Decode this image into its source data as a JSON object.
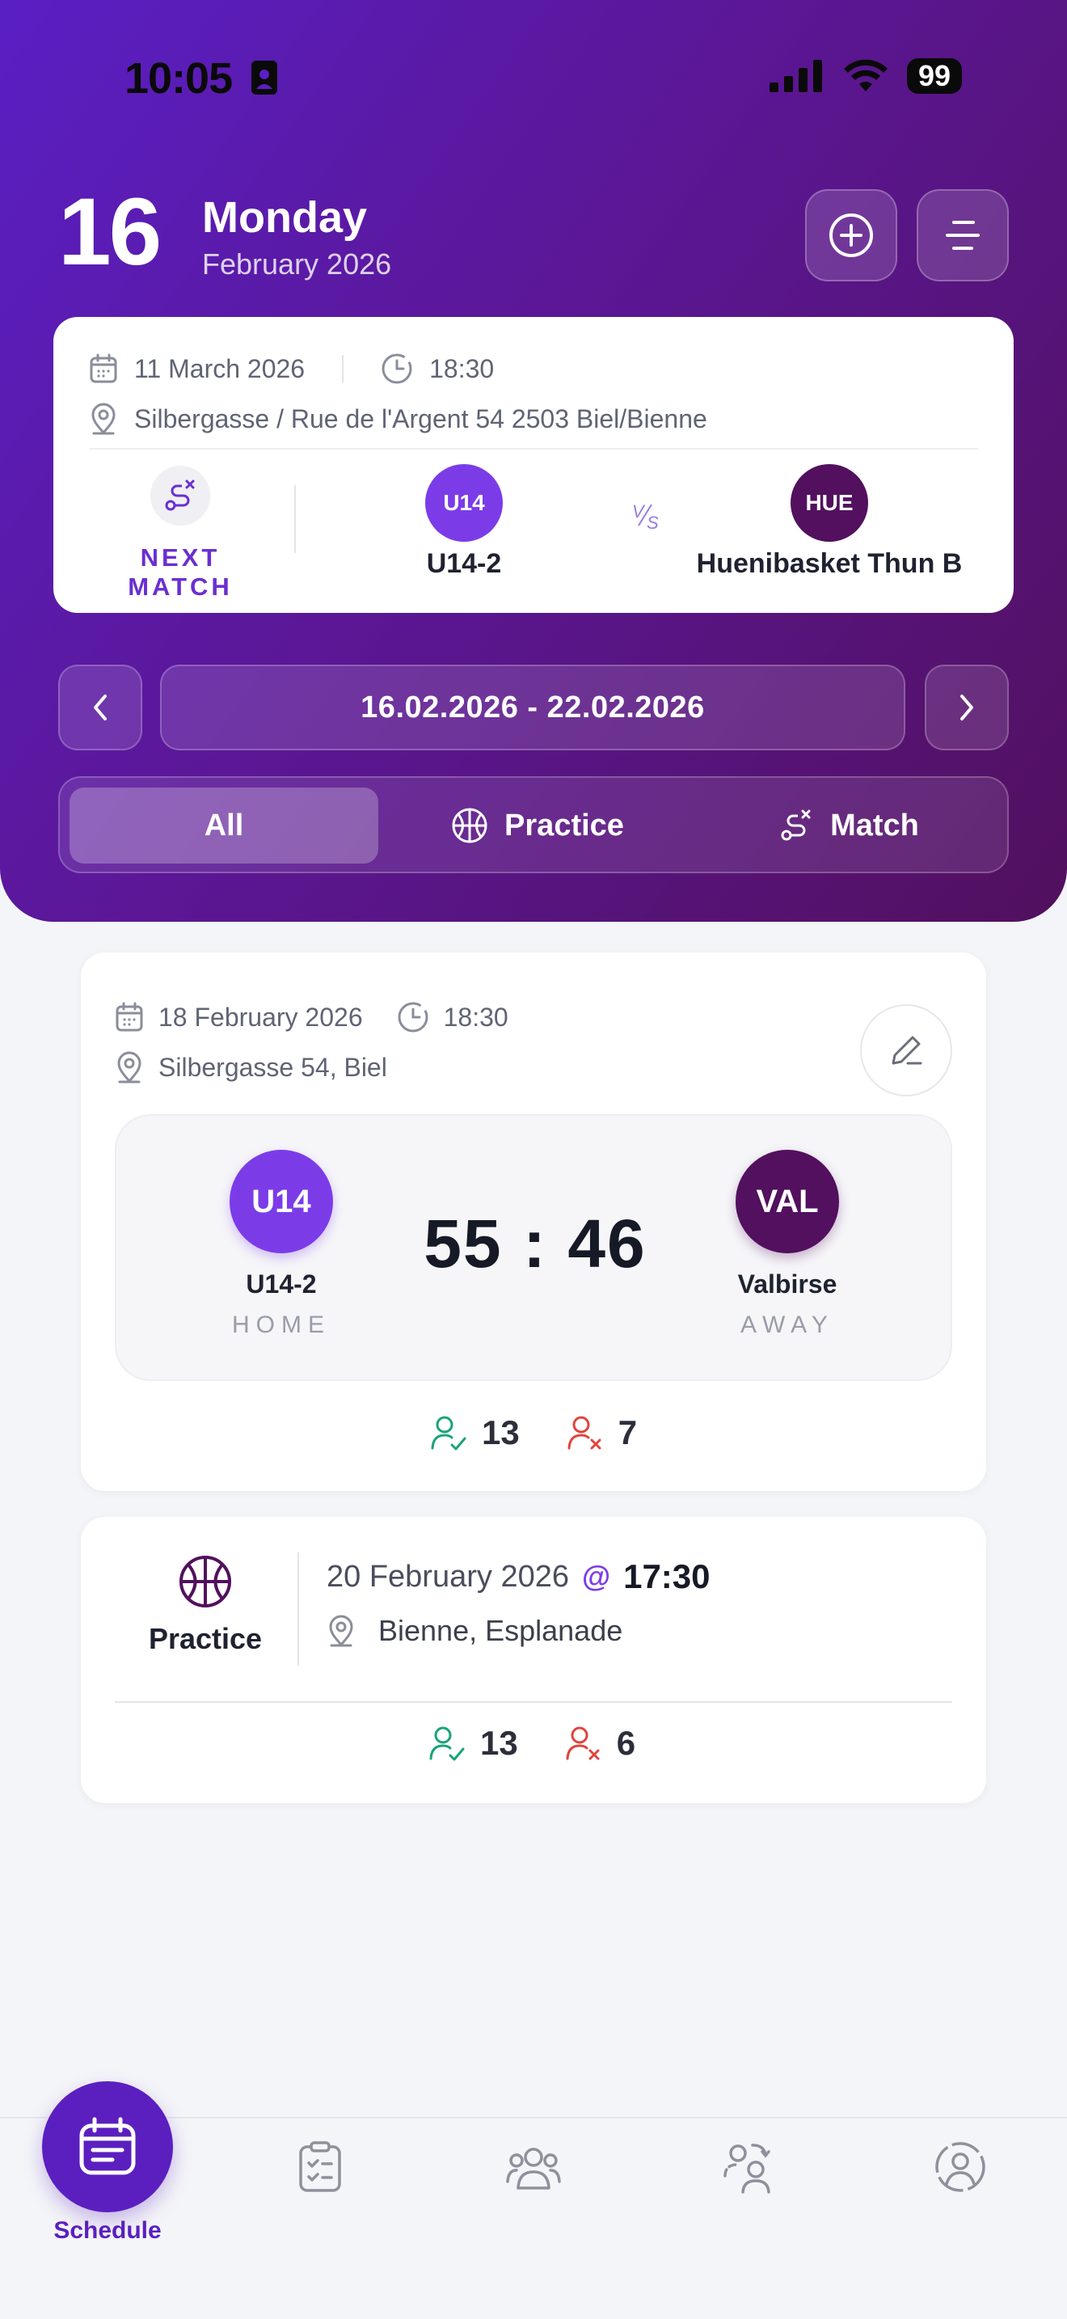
{
  "status_bar": {
    "time": "10:05",
    "battery": "99"
  },
  "header": {
    "day_number": "16",
    "weekday": "Monday",
    "month_year": "February 2026"
  },
  "next_match": {
    "date": "11 March 2026",
    "time": "18:30",
    "location": "Silbergasse / Rue de l'Argent 54 2503 Biel/Bienne",
    "label": "NEXT MATCH",
    "home_abbr": "U14",
    "home_name": "U14-2",
    "vs": "VS",
    "away_abbr": "HUE",
    "away_name": "Huenibasket Thun B"
  },
  "week": {
    "range": "16.02.2026 - 22.02.2026"
  },
  "filters": {
    "all": "All",
    "practice": "Practice",
    "match": "Match",
    "active": "All"
  },
  "events": {
    "match": {
      "date": "18 February 2026",
      "time": "18:30",
      "location": "Silbergasse 54, Biel",
      "home_abbr": "U14",
      "home_name": "U14-2",
      "home_label": "HOME",
      "score_home": "55",
      "score_sep": ":",
      "score_away": "46",
      "away_abbr": "VAL",
      "away_name": "Valbirse",
      "away_label": "AWAY",
      "attending": "13",
      "absent": "7"
    },
    "practice": {
      "type_label": "Practice",
      "date": "20 February 2026",
      "at": "@",
      "time": "17:30",
      "location": "Bienne, Esplanade",
      "attending": "13",
      "absent": "6"
    }
  },
  "tabbar": {
    "schedule_label": "Schedule"
  },
  "colors": {
    "primary": "#5b1fc0",
    "away_team": "#52105e",
    "home_team": "#7b3ce8",
    "attend": "#1aa37a",
    "absent": "#e0443c"
  }
}
